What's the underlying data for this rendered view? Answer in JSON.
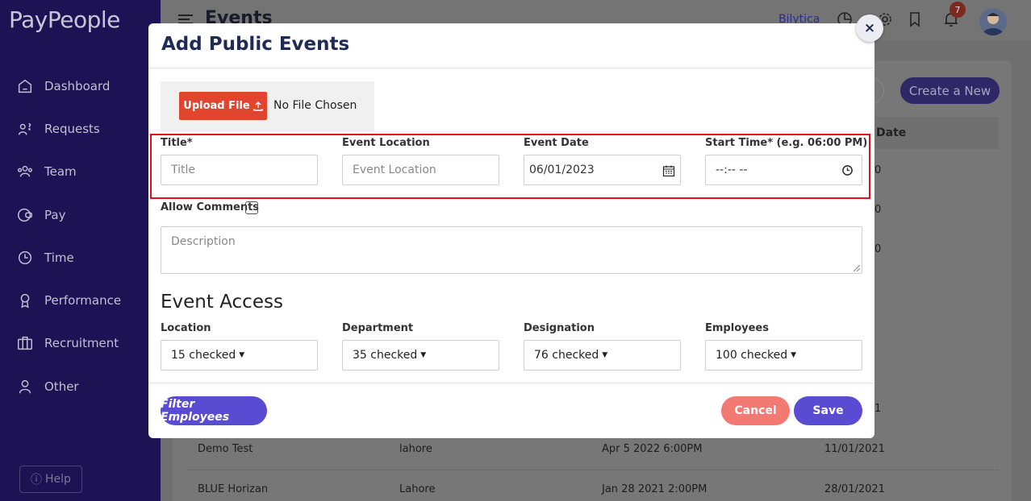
{
  "app": {
    "brand": "PayPeople",
    "company": "Bilytica",
    "page_title": "Events",
    "notifications_count": "7"
  },
  "sidebar": {
    "items": [
      {
        "label": "Dashboard",
        "icon": "home-icon"
      },
      {
        "label": "Requests",
        "icon": "requests-icon"
      },
      {
        "label": "Team",
        "icon": "team-icon"
      },
      {
        "label": "Pay",
        "icon": "wallet-icon"
      },
      {
        "label": "Time",
        "icon": "clock-icon"
      },
      {
        "label": "Performance",
        "icon": "award-icon"
      },
      {
        "label": "Recruitment",
        "icon": "briefcase-icon"
      },
      {
        "label": "Other",
        "icon": "user-icon"
      }
    ],
    "help_label": "Help"
  },
  "background": {
    "create_label": "Create a New",
    "date_header": "Date",
    "rows": [
      {
        "name": "Demo Test",
        "location": "lahore",
        "when": "Apr 5 2022 6:00PM",
        "date": "11/01/2021"
      },
      {
        "name": "BLUE Horizan",
        "location": "Lahore",
        "when": "Jan 28 2021 2:00PM",
        "date": "28/01/2021"
      }
    ],
    "peek_values": [
      "0",
      "0",
      "0",
      "1"
    ]
  },
  "modal": {
    "title": "Add Public Events",
    "close_glyph": "×",
    "upload_label": "Upload File",
    "file_status": "No File Chosen",
    "fields": {
      "title_label": "Title*",
      "title_placeholder": "Title",
      "location_label": "Event Location",
      "location_placeholder": "Event Location",
      "date_label": "Event Date",
      "date_value": "06/01/2023",
      "time_label": "Start Time* (e.g. 06:00 PM)",
      "time_value": "--:-- --"
    },
    "allow_comments_label": "Allow Comments",
    "allow_comments_checked": false,
    "description_placeholder": "Description",
    "access": {
      "title": "Event Access",
      "location_label": "Location",
      "location_value": "15 checked",
      "department_label": "Department",
      "department_value": "35 checked",
      "designation_label": "Designation",
      "designation_value": "76 checked",
      "employees_label": "Employees",
      "employees_value": "100 checked"
    },
    "buttons": {
      "filter": "Filter Employees",
      "cancel": "Cancel",
      "save": "Save"
    }
  },
  "colors": {
    "sidebar": "#1d1254",
    "primary": "#5a4bd3",
    "upload": "#e1452d",
    "cancel": "#f27a72",
    "highlight": "#e0101d",
    "title": "#1f2a57"
  }
}
